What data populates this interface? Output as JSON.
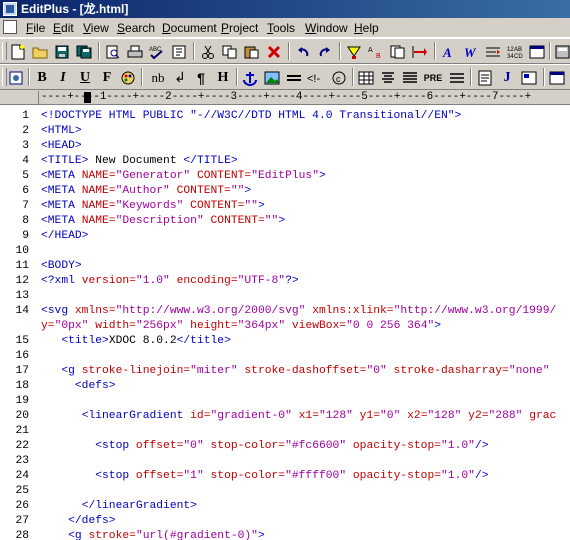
{
  "window": {
    "title": "EditPlus - [龙.html]"
  },
  "menu": {
    "items": [
      {
        "label": "File",
        "ul": "F",
        "rest": "ile"
      },
      {
        "label": "Edit",
        "ul": "E",
        "rest": "dit"
      },
      {
        "label": "View",
        "ul": "V",
        "rest": "iew"
      },
      {
        "label": "Search",
        "ul": "S",
        "rest": "earch"
      },
      {
        "label": "Document",
        "ul": "D",
        "rest": "ocument"
      },
      {
        "label": "Project",
        "ul": "P",
        "rest": "roject"
      },
      {
        "label": "Tools",
        "ul": "T",
        "rest": "ools"
      },
      {
        "label": "Window",
        "ul": "W",
        "rest": "indow"
      },
      {
        "label": "Help",
        "ul": "H",
        "rest": "elp"
      }
    ]
  },
  "toolbar_html": {
    "bold": "B",
    "italic": "I",
    "underline": "U",
    "font": "F",
    "nbsp": "nb",
    "br": "↲",
    "para": "¶",
    "heading": "H",
    "pre": "PRE",
    "script": "J"
  },
  "ruler": {
    "text": "----+----1----+----2----+----3----+----4----+----5----+----6----+----7----+"
  },
  "editor": {
    "lines": [
      {
        "n": "1",
        "parts": [
          {
            "c": "tg",
            "t": "<!DOCTYPE HTML PUBLIC \"-//W3C//DTD HTML 4.0 Transitional//EN\">"
          }
        ]
      },
      {
        "n": "2",
        "parts": [
          {
            "c": "tg",
            "t": "<HTML>"
          }
        ]
      },
      {
        "n": "3",
        "parts": [
          {
            "c": "tg",
            "t": "<HEAD>"
          }
        ]
      },
      {
        "n": "4",
        "parts": [
          {
            "c": "tg",
            "t": "<TITLE>"
          },
          {
            "c": "tx",
            "t": " New Document "
          },
          {
            "c": "tg",
            "t": "</TITLE>"
          }
        ]
      },
      {
        "n": "5",
        "parts": [
          {
            "c": "tg",
            "t": "<META "
          },
          {
            "c": "at",
            "t": "NAME="
          },
          {
            "c": "vl",
            "t": "\"Generator\""
          },
          {
            "c": "at",
            "t": " CONTENT="
          },
          {
            "c": "vl",
            "t": "\"EditPlus\""
          },
          {
            "c": "tg",
            "t": ">"
          }
        ]
      },
      {
        "n": "6",
        "parts": [
          {
            "c": "tg",
            "t": "<META "
          },
          {
            "c": "at",
            "t": "NAME="
          },
          {
            "c": "vl",
            "t": "\"Author\""
          },
          {
            "c": "at",
            "t": " CONTENT="
          },
          {
            "c": "vl",
            "t": "\"\""
          },
          {
            "c": "tg",
            "t": ">"
          }
        ]
      },
      {
        "n": "7",
        "parts": [
          {
            "c": "tg",
            "t": "<META "
          },
          {
            "c": "at",
            "t": "NAME="
          },
          {
            "c": "vl",
            "t": "\"Keywords\""
          },
          {
            "c": "at",
            "t": " CONTENT="
          },
          {
            "c": "vl",
            "t": "\"\""
          },
          {
            "c": "tg",
            "t": ">"
          }
        ]
      },
      {
        "n": "8",
        "parts": [
          {
            "c": "tg",
            "t": "<META "
          },
          {
            "c": "at",
            "t": "NAME="
          },
          {
            "c": "vl",
            "t": "\"Description\""
          },
          {
            "c": "at",
            "t": " CONTENT="
          },
          {
            "c": "vl",
            "t": "\"\""
          },
          {
            "c": "tg",
            "t": ">"
          }
        ]
      },
      {
        "n": "9",
        "parts": [
          {
            "c": "tg",
            "t": "</HEAD>"
          }
        ]
      },
      {
        "n": "10",
        "parts": []
      },
      {
        "n": "11",
        "parts": [
          {
            "c": "tg",
            "t": "<BODY>"
          }
        ]
      },
      {
        "n": "12",
        "parts": [
          {
            "c": "tg",
            "t": "<?xml "
          },
          {
            "c": "at",
            "t": "version="
          },
          {
            "c": "vl",
            "t": "\"1.0\""
          },
          {
            "c": "at",
            "t": " encoding="
          },
          {
            "c": "vl",
            "t": "\"UTF-8\""
          },
          {
            "c": "tg",
            "t": "?>"
          }
        ]
      },
      {
        "n": "13",
        "parts": []
      },
      {
        "n": "14",
        "parts": [
          {
            "c": "tg",
            "t": "<svg "
          },
          {
            "c": "at",
            "t": "xmlns="
          },
          {
            "c": "vl",
            "t": "\"http://www.w3.org/2000/svg\""
          },
          {
            "c": "at",
            "t": " xmlns:xlink="
          },
          {
            "c": "vl",
            "t": "\"http://www.w3.org/1999/"
          }
        ]
      },
      {
        "n": "",
        "parts": [
          {
            "c": "at",
            "t": "y="
          },
          {
            "c": "vl",
            "t": "\"0px\""
          },
          {
            "c": "at",
            "t": " width="
          },
          {
            "c": "vl",
            "t": "\"256px\""
          },
          {
            "c": "at",
            "t": " height="
          },
          {
            "c": "vl",
            "t": "\"364px\""
          },
          {
            "c": "at",
            "t": " viewBox="
          },
          {
            "c": "vl",
            "t": "\"0 0 256 364\""
          },
          {
            "c": "tg",
            "t": ">"
          }
        ]
      },
      {
        "n": "15",
        "parts": [
          {
            "c": "tx",
            "t": "   "
          },
          {
            "c": "tg",
            "t": "<title>"
          },
          {
            "c": "tx",
            "t": "XDOC 8.0.2"
          },
          {
            "c": "tg",
            "t": "</title>"
          }
        ]
      },
      {
        "n": "16",
        "parts": []
      },
      {
        "n": "17",
        "parts": [
          {
            "c": "tx",
            "t": "   "
          },
          {
            "c": "tg",
            "t": "<g "
          },
          {
            "c": "at",
            "t": "stroke-linejoin="
          },
          {
            "c": "vl",
            "t": "\"miter\""
          },
          {
            "c": "at",
            "t": " stroke-dashoffset="
          },
          {
            "c": "vl",
            "t": "\"0\""
          },
          {
            "c": "at",
            "t": " stroke-dasharray="
          },
          {
            "c": "vl",
            "t": "\"none\""
          }
        ]
      },
      {
        "n": "18",
        "parts": [
          {
            "c": "tx",
            "t": "     "
          },
          {
            "c": "tg",
            "t": "<defs>"
          }
        ]
      },
      {
        "n": "19",
        "parts": []
      },
      {
        "n": "20",
        "parts": [
          {
            "c": "tx",
            "t": "      "
          },
          {
            "c": "tg",
            "t": "<linearGradient "
          },
          {
            "c": "at",
            "t": "id="
          },
          {
            "c": "vl",
            "t": "\"gradient-0\""
          },
          {
            "c": "at",
            "t": " x1="
          },
          {
            "c": "vl",
            "t": "\"128\""
          },
          {
            "c": "at",
            "t": " y1="
          },
          {
            "c": "vl",
            "t": "\"0\""
          },
          {
            "c": "at",
            "t": " x2="
          },
          {
            "c": "vl",
            "t": "\"128\""
          },
          {
            "c": "at",
            "t": " y2="
          },
          {
            "c": "vl",
            "t": "\"288\""
          },
          {
            "c": "at",
            "t": " grac"
          }
        ]
      },
      {
        "n": "21",
        "parts": []
      },
      {
        "n": "22",
        "parts": [
          {
            "c": "tx",
            "t": "        "
          },
          {
            "c": "tg",
            "t": "<stop "
          },
          {
            "c": "at",
            "t": "offset="
          },
          {
            "c": "vl",
            "t": "\"0\""
          },
          {
            "c": "at",
            "t": " stop-color="
          },
          {
            "c": "vl",
            "t": "\"#fc6600\""
          },
          {
            "c": "at",
            "t": " opacity-stop="
          },
          {
            "c": "vl",
            "t": "\"1.0\""
          },
          {
            "c": "tg",
            "t": "/>"
          }
        ]
      },
      {
        "n": "23",
        "parts": []
      },
      {
        "n": "24",
        "parts": [
          {
            "c": "tx",
            "t": "        "
          },
          {
            "c": "tg",
            "t": "<stop "
          },
          {
            "c": "at",
            "t": "offset="
          },
          {
            "c": "vl",
            "t": "\"1\""
          },
          {
            "c": "at",
            "t": " stop-color="
          },
          {
            "c": "vl",
            "t": "\"#ffff00\""
          },
          {
            "c": "at",
            "t": " opacity-stop="
          },
          {
            "c": "vl",
            "t": "\"1.0\""
          },
          {
            "c": "tg",
            "t": "/>"
          }
        ]
      },
      {
        "n": "25",
        "parts": []
      },
      {
        "n": "26",
        "parts": [
          {
            "c": "tx",
            "t": "      "
          },
          {
            "c": "tg",
            "t": "</linearGradient>"
          }
        ]
      },
      {
        "n": "27",
        "parts": [
          {
            "c": "tx",
            "t": "    "
          },
          {
            "c": "tg",
            "t": "</defs>"
          }
        ]
      },
      {
        "n": "28",
        "parts": [
          {
            "c": "tx",
            "t": "    "
          },
          {
            "c": "tg",
            "t": "<g "
          },
          {
            "c": "at",
            "t": "stroke="
          },
          {
            "c": "vl",
            "t": "\"url(#gradient-0)\""
          },
          {
            "c": "tg",
            "t": ">"
          }
        ]
      }
    ]
  },
  "colors": {
    "tag": "#0000c0",
    "attr": "#c00000",
    "value": "#a000a0",
    "title_bar": "#0a246a",
    "chrome": "#d4d0c8"
  }
}
